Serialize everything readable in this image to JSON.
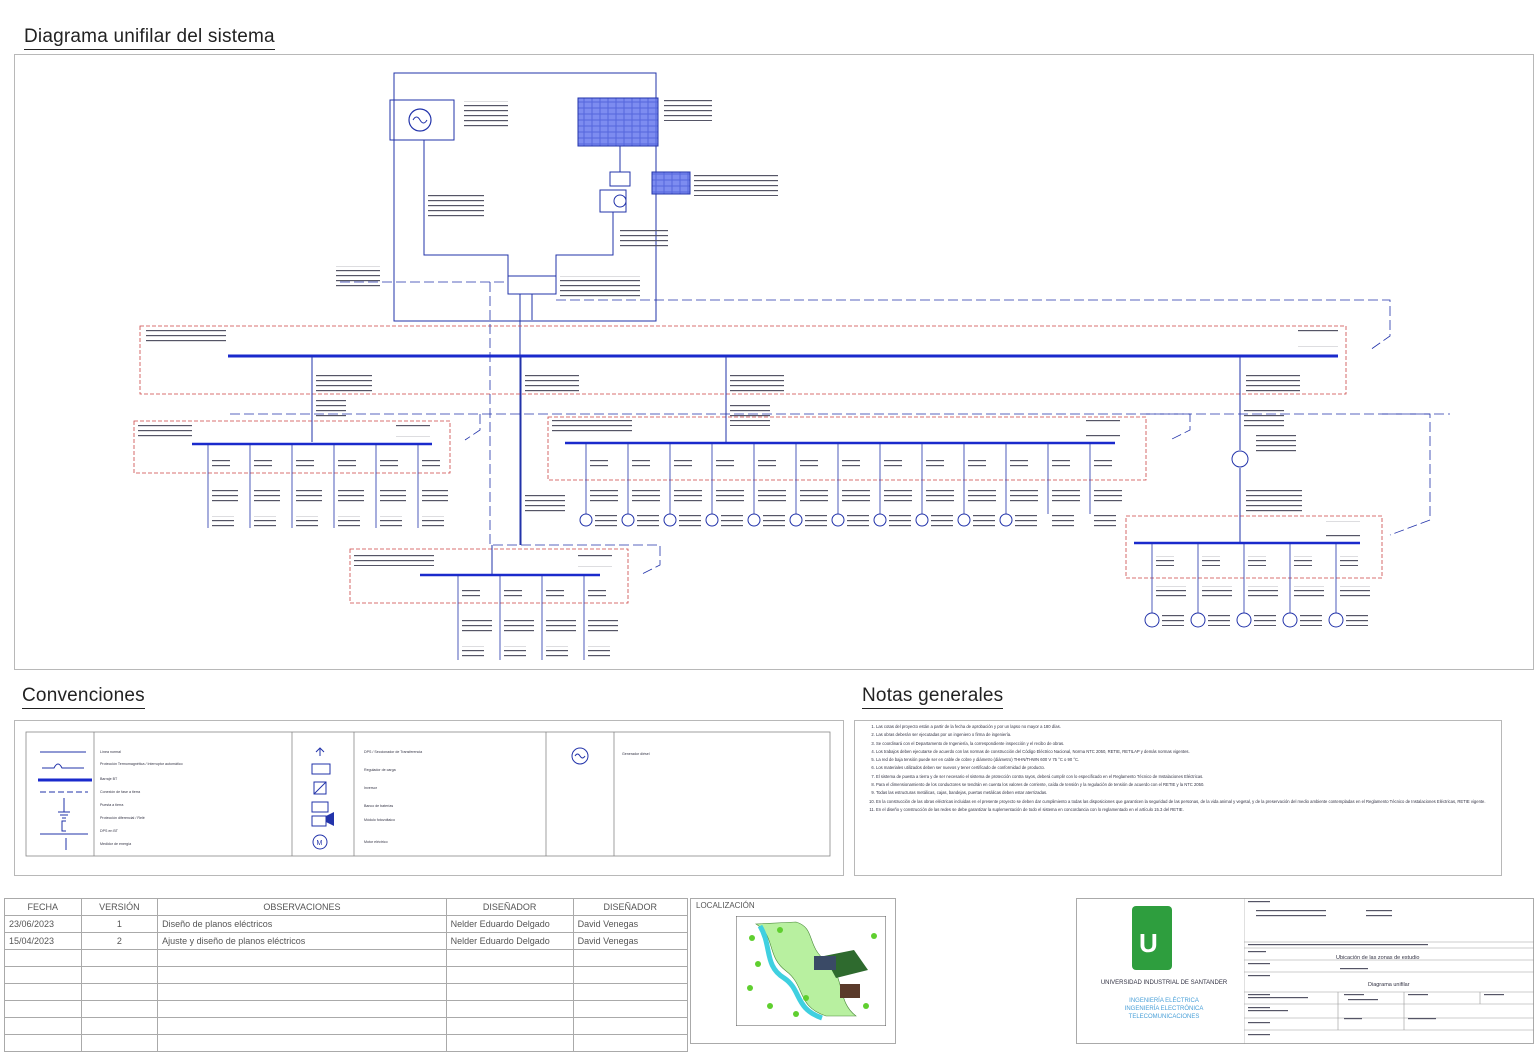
{
  "titles": {
    "diagram": "Diagrama unifilar del sistema",
    "conventions": "Convenciones",
    "notes": "Notas generales"
  },
  "colors": {
    "line": "#2233aa",
    "bus": "#1a2acc",
    "dash_red": "#cc4444",
    "frame": "#b8b8b8",
    "logo": "#2e9e3e"
  },
  "conventions": {
    "col1": [
      "Línea normal",
      "Protección Termomagnética / Interruptor automático",
      "Barraje BT",
      "Conexión de fase a tierra",
      "Puesta a tierra",
      "Protección diferencial / Relé",
      "DPS en BT",
      "Medidor de energía"
    ],
    "col2": [
      "DPS / Seccionador de Transferencia",
      "Regulador de carga",
      "Inversor",
      "Banco de baterías",
      "Módulo fotovoltaico",
      "Motor eléctrico"
    ],
    "col3": [
      "Generador diésel"
    ]
  },
  "notes": [
    "Las cotas del proyecto están a partir de la fecha de aprobación y por un lapso no mayor a 180 días.",
    "Las obras deberán ser ejecutadas por un ingeniero o firma de ingeniería.",
    "Se coordinará con el Departamento de Ingeniería, la correspondiente inspección y el recibo de obras.",
    "Los trabajos deben ejecutarse de acuerdo con las normas de construcción del Código Eléctrico Nacional, Norma NTC 2050, RETIE, RETILAP y demás normas vigentes.",
    "La red de baja tensión puede ser en cable de cobre y diámetro (diámetro) THHN/THWN 600 V 75 °C o 90 °C.",
    "Los materiales utilizados deben ser nuevos y tener certificado de conformidad de producto.",
    "El sistema de puesta a tierra y de ser necesario el sistema de protección contra rayos, deberá cumplir con lo especificado en el Reglamento Técnico de Instalaciones Eléctricas.",
    "Para el dimensionamiento de los conductores se tendrán en cuenta los valores de corriente, caída de tensión y la regulación de tensión de acuerdo con el RETIE y la NTC 2050.",
    "Todas las estructuras metálicas, cajas, bandejas, puertas metálicas deben estar aterrizadas.",
    "En la construcción de las obras eléctricas incluidas en el presente proyecto se deben dar cumplimiento a todas las disposiciones que garanticen la seguridad de las personas, de la vida animal y vegetal, y de la preservación del medio ambiente contempladas en el Reglamento Técnico de Instalaciones Eléctricas, RETIE vigente.",
    "En el diseño y construcción de las redes se debe garantizar la suplementación de todo el sistema en concordancia con lo reglamentado en el artículo 15.3 del RETIE."
  ],
  "revision_table": {
    "headers": [
      "FECHA",
      "VERSIÓN",
      "OBSERVACIONES",
      "DISEÑADOR",
      "DISEÑADOR"
    ],
    "rows": [
      [
        "23/06/2023",
        "1",
        "Diseño de planos eléctricos",
        "Nelder Eduardo Delgado",
        "David Venegas"
      ],
      [
        "15/04/2023",
        "2",
        "Ajuste y diseño de planos eléctricos",
        "Nelder Eduardo Delgado",
        "David Venegas"
      ]
    ],
    "location_label": "LOCALIZACIÓN"
  },
  "title_block": {
    "university": "UNIVERSIDAD INDUSTRIAL DE SANTANDER",
    "schools": [
      "INGENIERÍA ELÉCTRICA",
      "INGENIERÍA ELECTRÓNICA",
      "TELECOMUNICACIONES"
    ],
    "project_title": "Ubicación de las zonas de estudio",
    "sheet_name": "Diagrama unifilar"
  }
}
